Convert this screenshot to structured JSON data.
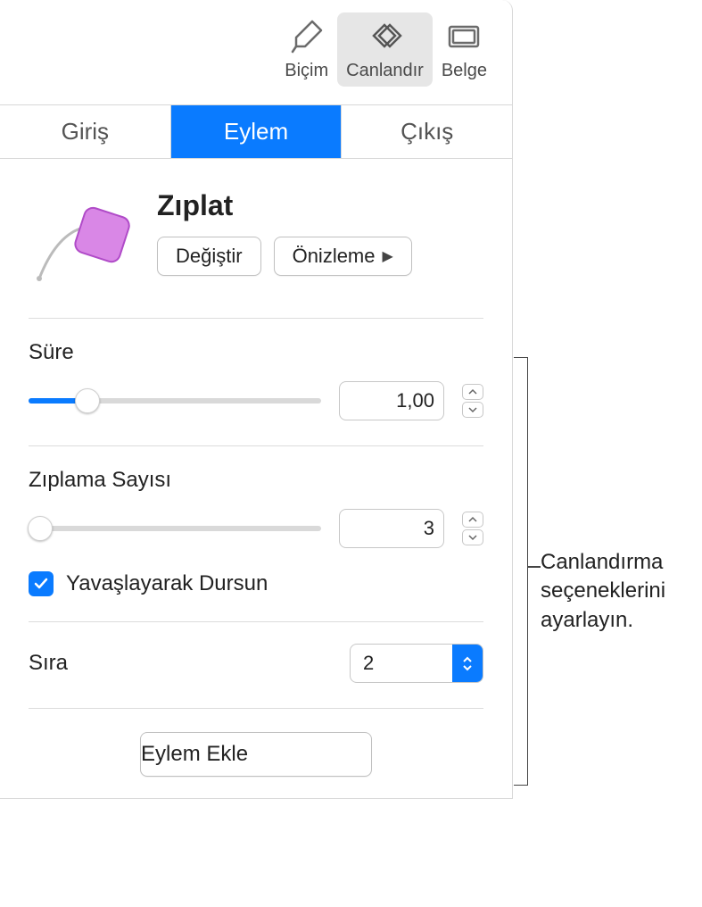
{
  "toolbar": {
    "format": "Biçim",
    "animate": "Canlandır",
    "document": "Belge"
  },
  "tabs": {
    "in": "Giriş",
    "action": "Eylem",
    "out": "Çıkış"
  },
  "effect": {
    "name": "Zıplat",
    "change": "Değiştir",
    "preview": "Önizleme"
  },
  "duration": {
    "label": "Süre",
    "value": "1,00",
    "slider_percent": 20
  },
  "bounces": {
    "label": "Zıplama Sayısı",
    "value": "3",
    "slider_percent": 4,
    "ease_stop_label": "Yavaşlayarak Dursun",
    "ease_stop_checked": true
  },
  "order": {
    "label": "Sıra",
    "value": "2"
  },
  "add_action": "Eylem Ekle",
  "callout": "Canlandırma seçeneklerini ayarlayın."
}
